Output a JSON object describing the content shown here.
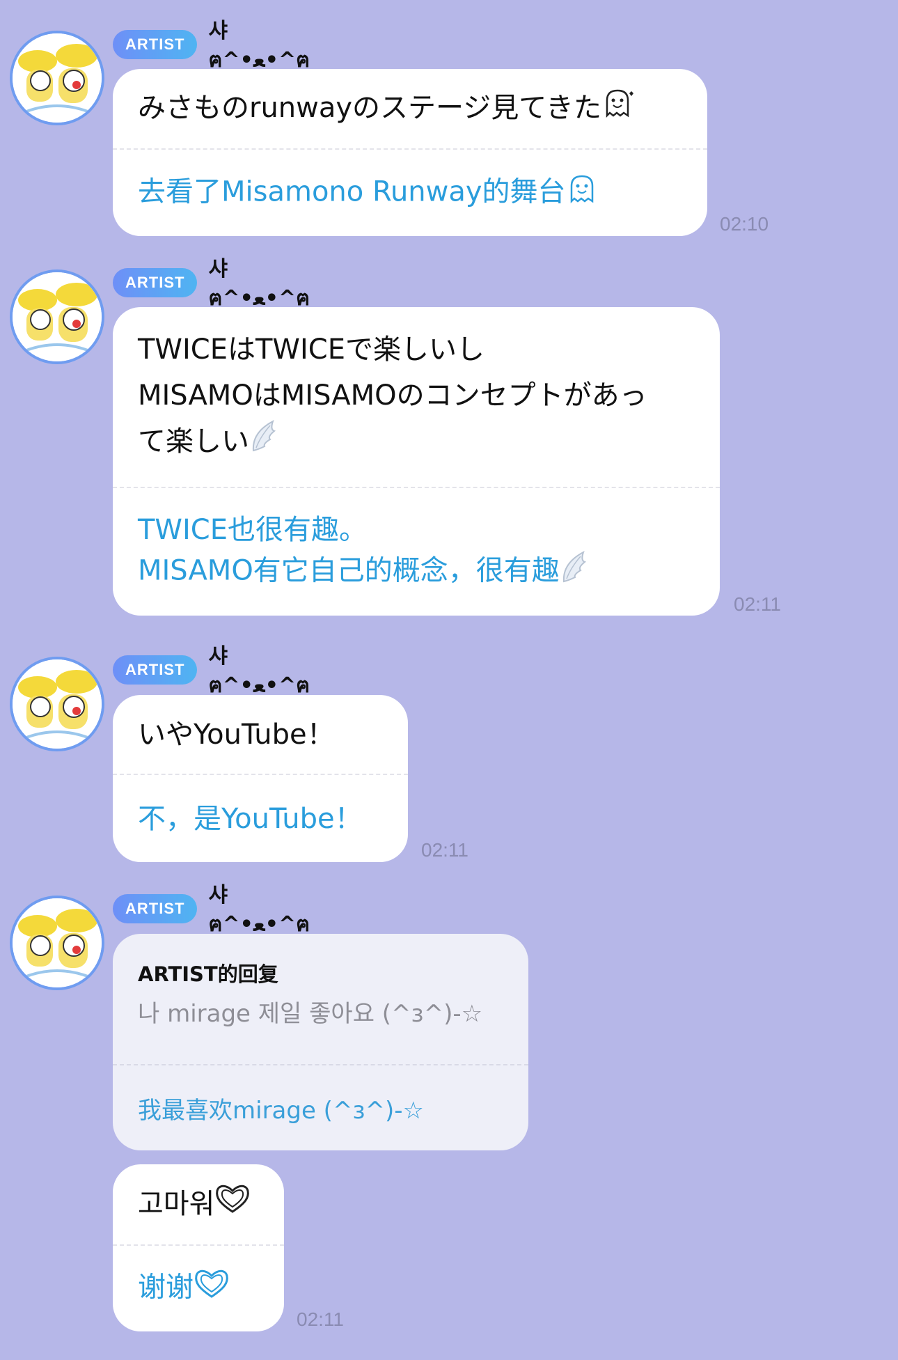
{
  "messages": [
    {
      "badge": "ARTIST",
      "sender": "샤ฅ^•ﻌ•^ฅ",
      "original_lines": [
        "みさものrunwayのステージ見てきた"
      ],
      "translation_lines": [
        "去看了Misamono Runway的舞台"
      ],
      "emoji": "ghost-tongue-icon",
      "time": "02:10"
    },
    {
      "badge": "ARTIST",
      "sender": "샤ฅ^•ﻌ•^ฅ",
      "original_lines": [
        "TWICEはTWICEで楽しいし",
        "MISAMOはMISAMOのコンセプトがあっ",
        "て楽しい"
      ],
      "translation_lines": [
        "TWICE也很有趣。",
        "MISAMO有它自己的概念，很有趣"
      ],
      "emoji": "wing-icon",
      "time": "02:11"
    },
    {
      "badge": "ARTIST",
      "sender": "샤ฅ^•ﻌ•^ฅ",
      "original_lines": [
        "いやYouTube！"
      ],
      "translation_lines": [
        "不，是YouTube！"
      ],
      "time": "02:11"
    },
    {
      "badge": "ARTIST",
      "sender": "샤ฅ^•ﻌ•^ฅ",
      "reply": {
        "heading": "ARTIST的回复",
        "quoted": "나 mirage 제일 좋아요 (^ɜ^)-☆",
        "quoted_translation": "我最喜欢mirage (^ɜ^)-☆"
      },
      "original_lines": [
        "고마워"
      ],
      "translation_lines": [
        "谢谢"
      ],
      "emoji": "heart-outline-icon",
      "time": "02:11"
    }
  ],
  "colors": {
    "background": "#b6b7e8",
    "bubble": "#ffffff",
    "reply_bubble": "#eeeff8",
    "translation_text": "#2a9ddc",
    "badge_start": "#6e8ff7",
    "badge_end": "#4fb4f2",
    "avatar_ring": "#6f9cf0"
  }
}
